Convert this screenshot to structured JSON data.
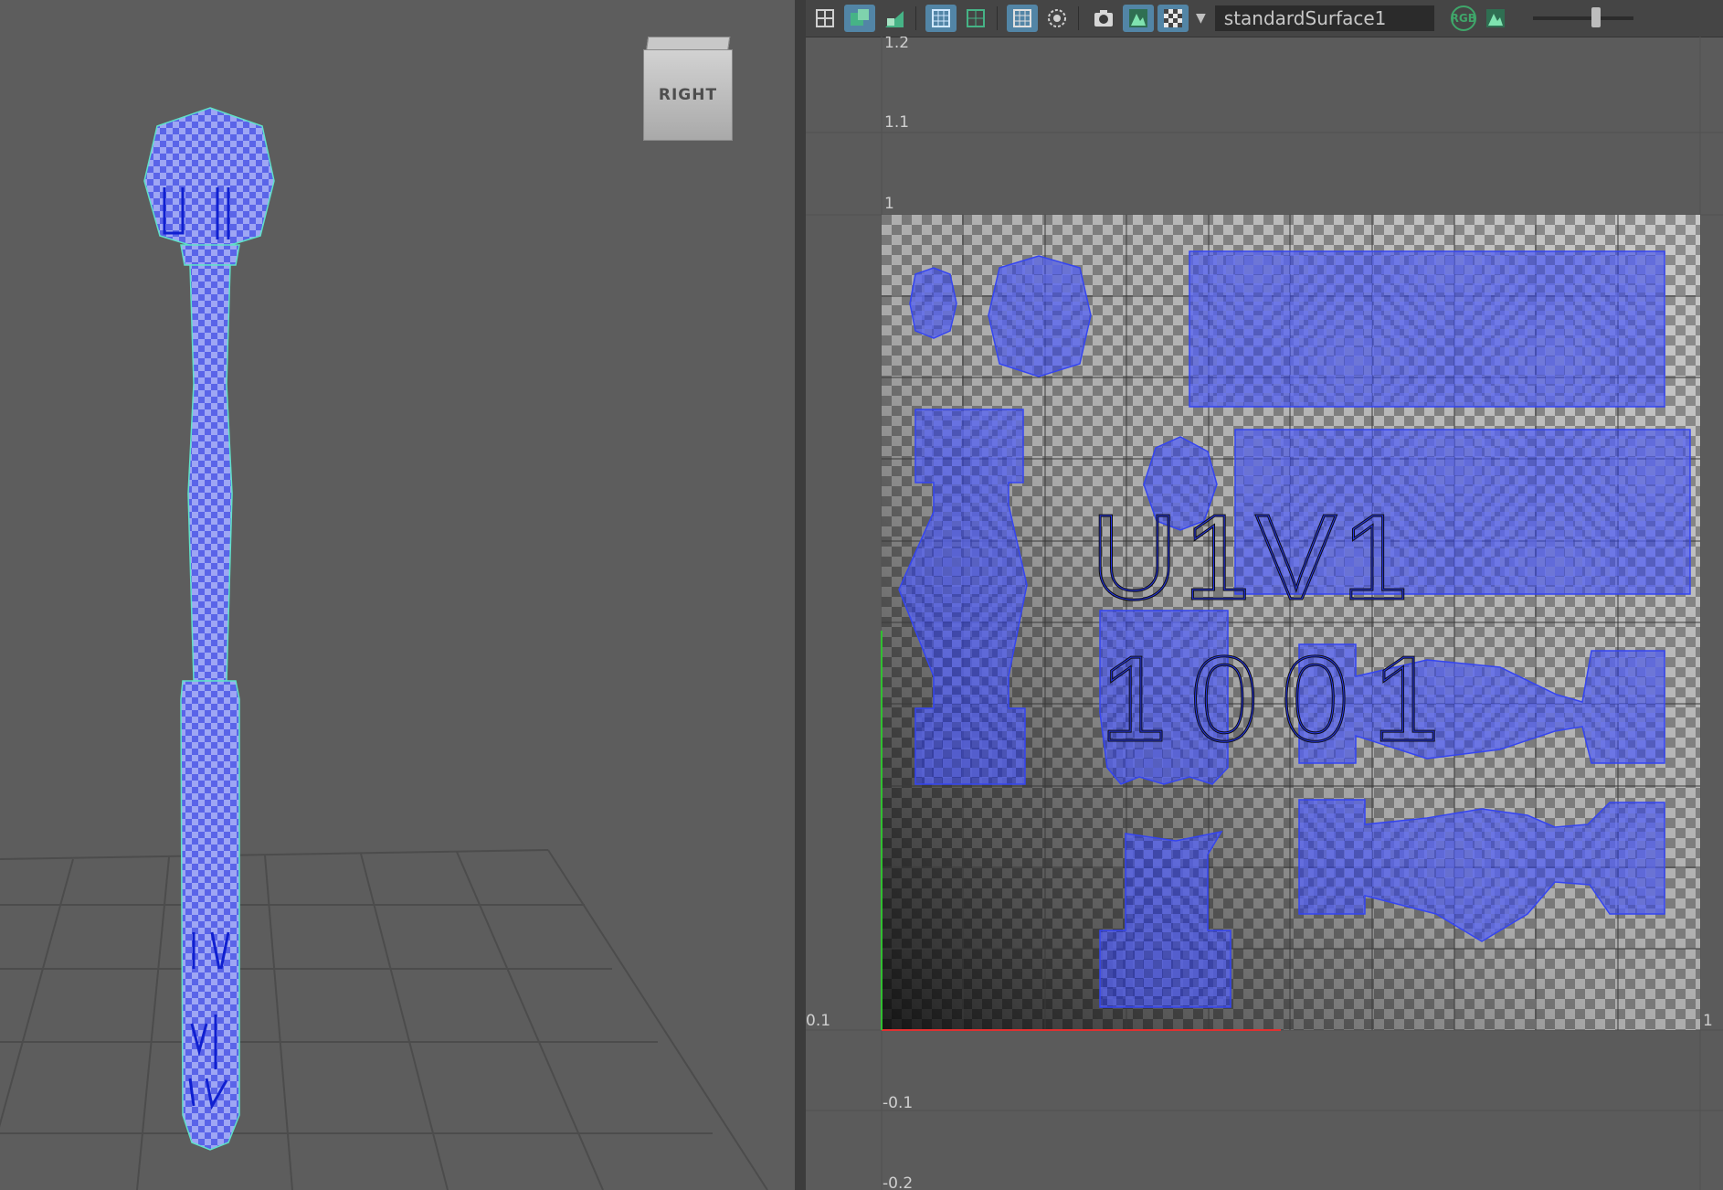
{
  "viewport": {
    "view_cube_label": "RIGHT"
  },
  "uv_editor": {
    "shader_name": "standardSurface1",
    "rgb_label": "RGB",
    "tile_label_top": "U1V1",
    "tile_label_bottom": "1001",
    "axis_labels": {
      "v_1_2": "1.2",
      "v_1_1": "1.1",
      "v_1": "1",
      "origin": "0.1",
      "u_1": "1",
      "v_neg_0_1": "-0.1",
      "v_neg_0_2": "-0.2"
    }
  },
  "colors": {
    "uv_shell_blue": "#2f3ff0",
    "selection_cyan": "#5fe0c8",
    "grid_dark": "#4a4a4a",
    "toolbar_active": "#5285a6"
  },
  "icons": [
    "grid-icon",
    "uv-shell-icon",
    "uv-distortion-icon",
    "texture-tile-icon",
    "grid-snap-icon",
    "pixel-grid-icon",
    "isolate-icon",
    "snapshot-icon",
    "image-icon",
    "checker-icon",
    "rgb-channel-icon",
    "exposure-icon"
  ]
}
